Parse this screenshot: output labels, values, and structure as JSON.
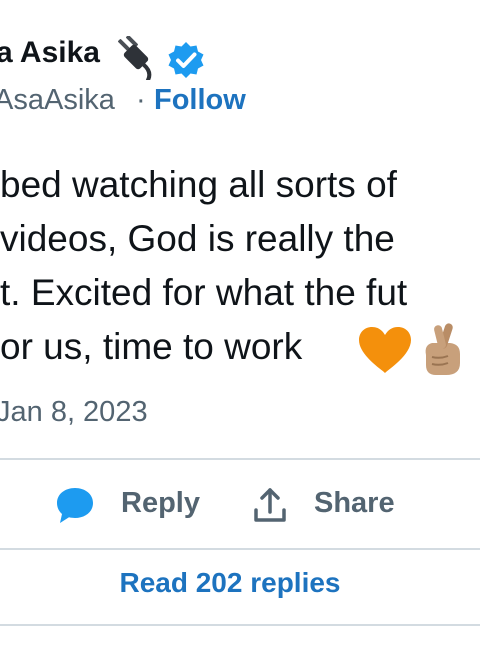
{
  "header": {
    "name": "a Asika",
    "handle": "AsaAsika",
    "separator": "·",
    "follow_label": "Follow"
  },
  "tweet": {
    "lines": [
      "bed watching all sorts of",
      "videos, God is really the",
      "t. Excited for what the fut",
      "or us, time to work"
    ],
    "emoji": [
      "orange-heart",
      "crossed-fingers-medium-skin-tone"
    ],
    "date": "Jan 8, 2023"
  },
  "actions": {
    "reply_label": "Reply",
    "share_label": "Share",
    "read_replies_label": "Read 202 replies"
  },
  "colors": {
    "link": "#1d73bf",
    "secondary_text": "#536471",
    "reply_icon": "#1d9bf0",
    "verified": "#1d9bf0",
    "heart": "#f4900c",
    "divider": "#d3dbe1"
  }
}
